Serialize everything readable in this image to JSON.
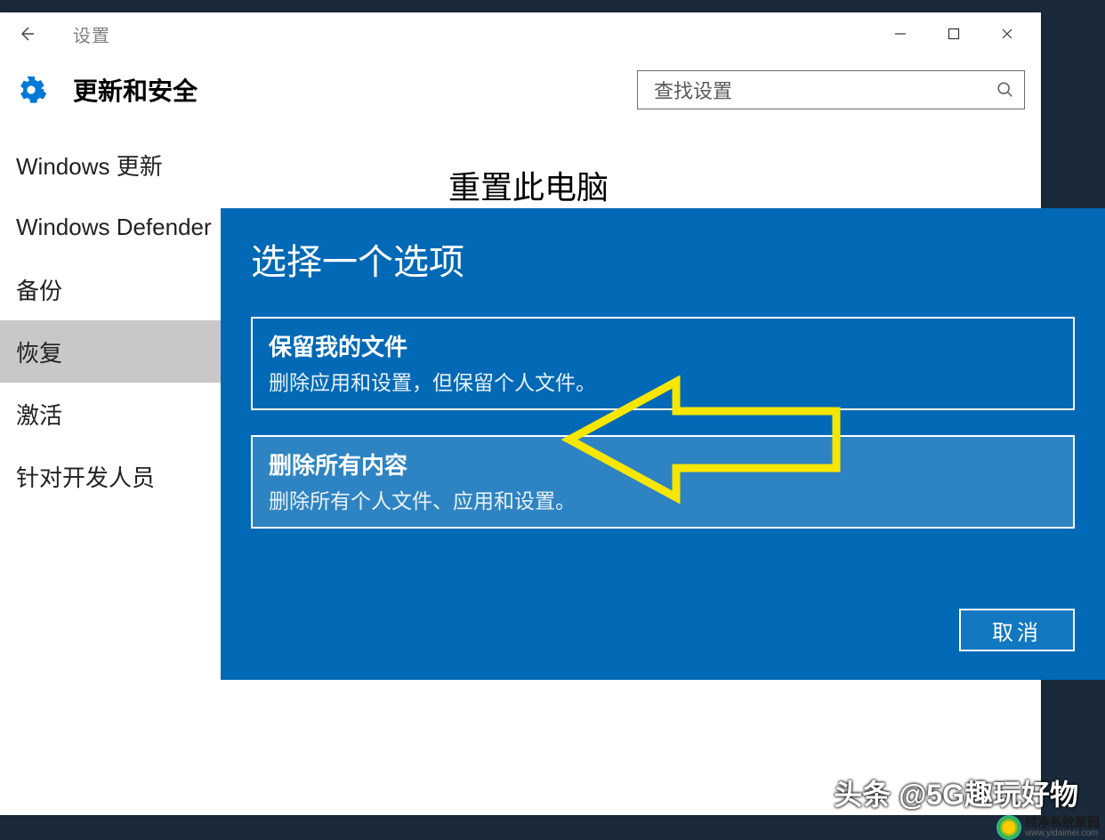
{
  "titlebar": {
    "app_name": "设置"
  },
  "header": {
    "title": "更新和安全",
    "search_placeholder": "查找设置"
  },
  "sidebar": {
    "items": [
      {
        "label": "Windows 更新",
        "active": false
      },
      {
        "label": "Windows Defender",
        "active": false
      },
      {
        "label": "备份",
        "active": false
      },
      {
        "label": "恢复",
        "active": true
      },
      {
        "label": "激活",
        "active": false
      },
      {
        "label": "针对开发人员",
        "active": false
      }
    ]
  },
  "main": {
    "title": "重置此电脑"
  },
  "dialog": {
    "title": "选择一个选项",
    "options": [
      {
        "title": "保留我的文件",
        "desc": "删除应用和设置，但保留个人文件。"
      },
      {
        "title": "删除所有内容",
        "desc": "删除所有个人文件、应用和设置。"
      }
    ],
    "cancel": "取消"
  },
  "watermark": {
    "source": "头条 @5G趣玩好物",
    "brand": "纯净系统家园",
    "url": "www.yidaimei.com"
  },
  "annotation": {
    "arrow_color": "#f7e600",
    "points_to_option_index": 1
  }
}
